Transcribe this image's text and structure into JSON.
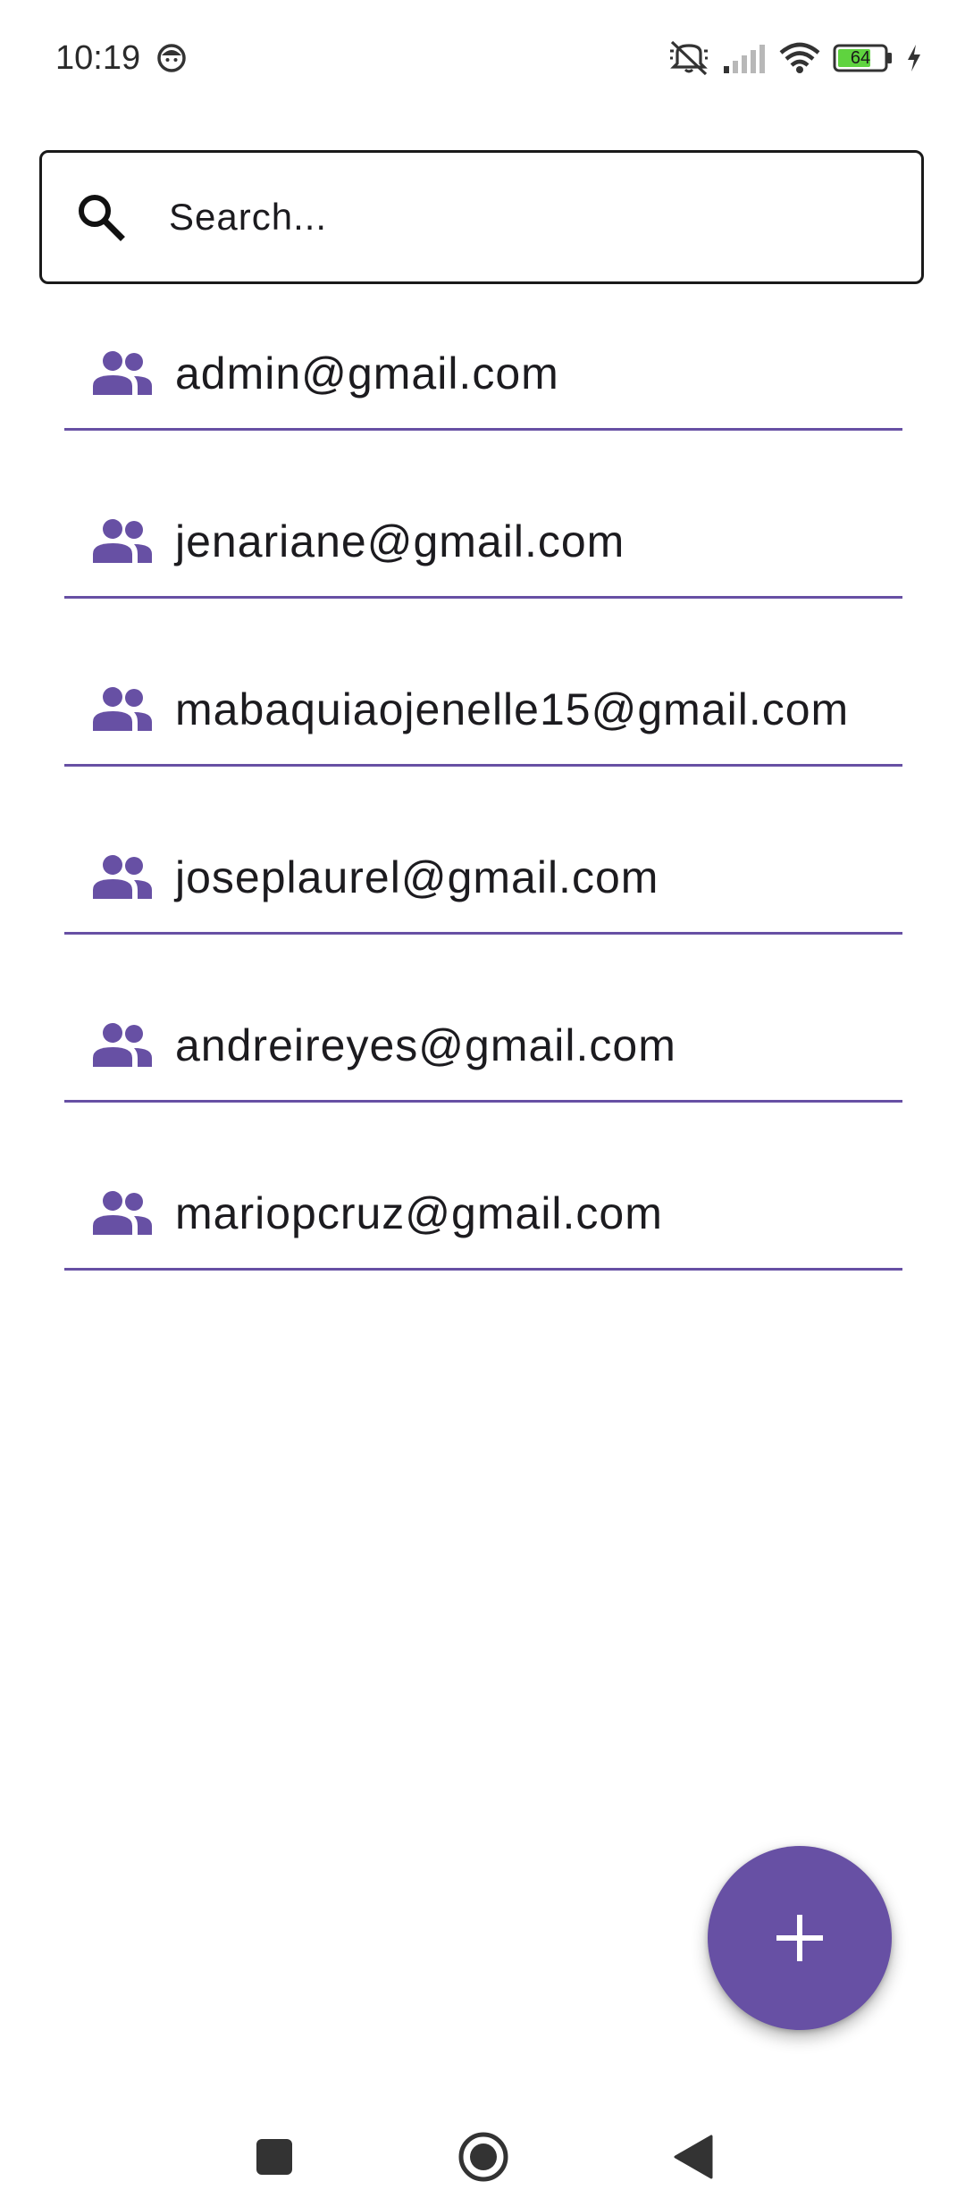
{
  "status_bar": {
    "time": "10:19",
    "battery_level": "64",
    "icons": [
      "face-notification-icon",
      "mute-icon",
      "signal-icon",
      "wifi-icon",
      "battery-icon",
      "charging-icon"
    ]
  },
  "search": {
    "placeholder": "Search...",
    "value": ""
  },
  "users": [
    {
      "email": "admin@gmail.com",
      "icon": "group-icon"
    },
    {
      "email": "jenariane@gmail.com",
      "icon": "group-icon"
    },
    {
      "email": "mabaquiaojenelle15@gmail.com",
      "icon": "group-icon"
    },
    {
      "email": "joseplaurel@gmail.com",
      "icon": "group-icon"
    },
    {
      "email": "andreireyes@gmail.com",
      "icon": "group-icon"
    },
    {
      "email": "mariopcruz@gmail.com",
      "icon": "group-icon"
    }
  ],
  "fab": {
    "icon": "plus-icon"
  },
  "nav_bar": {
    "buttons": [
      "recents-icon",
      "home-icon",
      "back-icon"
    ]
  },
  "colors": {
    "accent": "#6750a4",
    "text": "#1c1b1f",
    "battery_fill": "#5fd33f"
  }
}
